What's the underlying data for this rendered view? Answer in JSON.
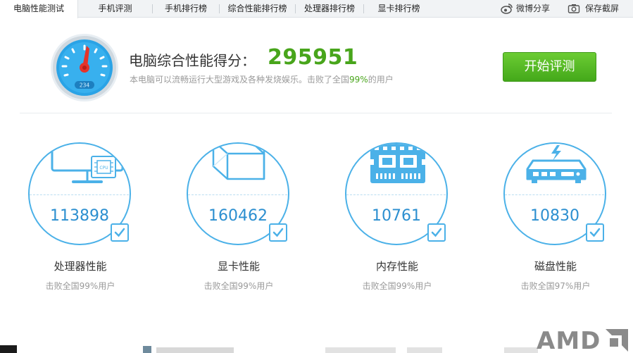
{
  "tabs": [
    {
      "label": "电脑性能测试",
      "active": true
    },
    {
      "label": "手机评测",
      "active": false
    },
    {
      "label": "手机排行榜",
      "active": false
    },
    {
      "label": "综合性能排行榜",
      "active": false
    },
    {
      "label": "处理器排行榜",
      "active": false
    },
    {
      "label": "显卡排行榜",
      "active": false
    }
  ],
  "actions": {
    "share_label": "微博分享",
    "screenshot_label": "保存截屏"
  },
  "score": {
    "title": "电脑综合性能得分：",
    "value": "295951",
    "desc_prefix": "本电脑可以流畅运行大型游戏及各种发烧娱乐。击败了全国",
    "desc_percent": "99%",
    "desc_suffix": "的用户",
    "gauge_reading": "234",
    "start_button": "开始评测"
  },
  "metrics": [
    {
      "name": "处理器性能",
      "value": "113898",
      "sub": "击败全国99%用户",
      "icon": "cpu-monitor-icon",
      "icon_label": "CPU"
    },
    {
      "name": "显卡性能",
      "value": "160462",
      "sub": "击败全国99%用户",
      "icon": "graphics-cube-icon"
    },
    {
      "name": "内存性能",
      "value": "10761",
      "sub": "击败全国99%用户",
      "icon": "memory-chip-icon"
    },
    {
      "name": "磁盘性能",
      "value": "10830",
      "sub": "击败全国97%用户",
      "icon": "disk-drive-icon"
    }
  ],
  "brand": {
    "logo_text": "AMD"
  },
  "colors": {
    "accent_blue": "#4bb1e8",
    "value_blue": "#2c8fd0",
    "score_green": "#48a51b",
    "button_green": "#5abd28"
  }
}
